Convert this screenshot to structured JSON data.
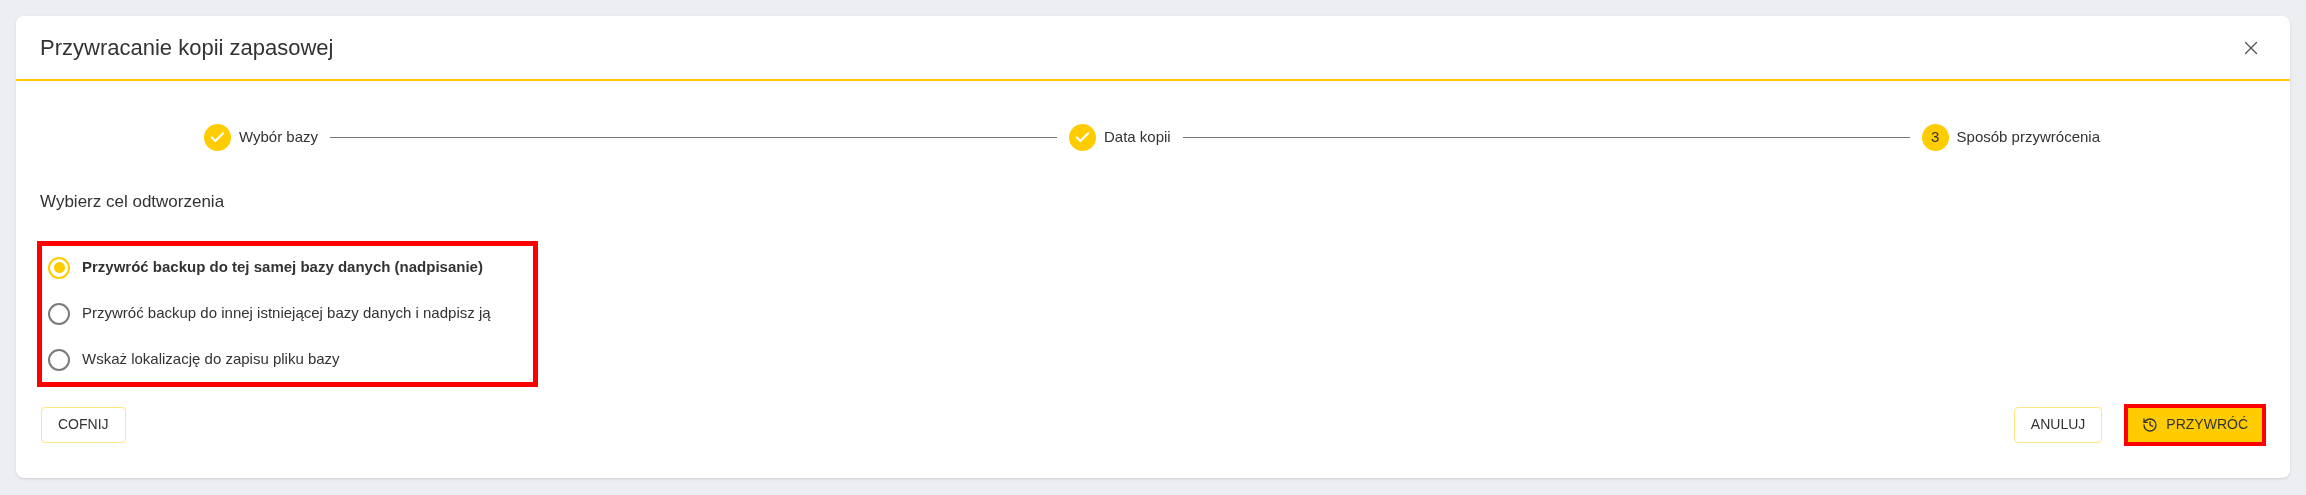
{
  "dialog": {
    "title": "Przywracanie kopii zapasowej"
  },
  "steps": [
    {
      "label": "Wybór bazy",
      "completed": true
    },
    {
      "label": "Data kopii",
      "completed": true
    },
    {
      "label": "Sposób przywrócenia",
      "completed": false,
      "number": "3"
    }
  ],
  "section_title": "Wybierz cel odtworzenia",
  "options_highlighted": true,
  "options": [
    {
      "label": "Przywróć backup do tej samej bazy danych (nadpisanie)",
      "selected": true
    },
    {
      "label": "Przywróć backup do innej istniejącej bazy danych i nadpisz ją",
      "selected": false
    },
    {
      "label": "Wskaż lokalizację do zapisu pliku bazy",
      "selected": false
    }
  ],
  "buttons": {
    "back": "COFNIJ",
    "cancel": "ANULUJ",
    "restore": {
      "label": "PRZYWRÓĆ",
      "highlighted": true
    }
  }
}
